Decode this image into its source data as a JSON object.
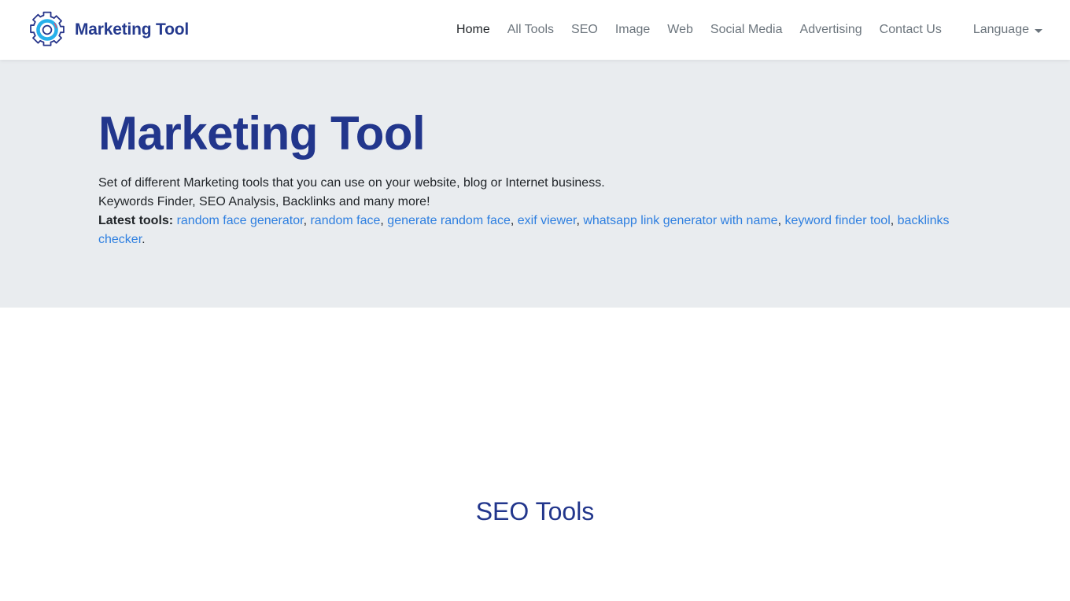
{
  "header": {
    "brand": {
      "name": "Marketing Tool",
      "logo_icon": "gear-logo-icon",
      "logo_outline_color": "#26348a",
      "logo_ring_color": "#27b0ea"
    },
    "nav": [
      {
        "label": "Home",
        "active": true
      },
      {
        "label": "All Tools",
        "active": false
      },
      {
        "label": "SEO",
        "active": false
      },
      {
        "label": "Image",
        "active": false
      },
      {
        "label": "Web",
        "active": false
      },
      {
        "label": "Social Media",
        "active": false
      },
      {
        "label": "Advertising",
        "active": false
      },
      {
        "label": "Contact Us",
        "active": false
      }
    ],
    "language_dropdown": {
      "label": "Language",
      "caret_icon": "chevron-down-icon"
    }
  },
  "hero": {
    "title": "Marketing Tool",
    "line1": "Set of different Marketing tools that you can use on your website, blog or Internet business.",
    "line2": "Keywords Finder, SEO Analysis, Backlinks and many more!",
    "latest_label": "Latest tools:",
    "latest_links": [
      "random face generator",
      "random face",
      "generate random face",
      "exif viewer",
      "whatsapp link generator with name",
      "keyword finder tool",
      "backlinks checker"
    ],
    "latest_separator": ", ",
    "latest_terminator": ".",
    "background_color": "#e9ecef",
    "title_color": "#22368c",
    "link_color": "#2e7fe0"
  },
  "main": {
    "sections": [
      {
        "title": "SEO Tools"
      }
    ]
  }
}
